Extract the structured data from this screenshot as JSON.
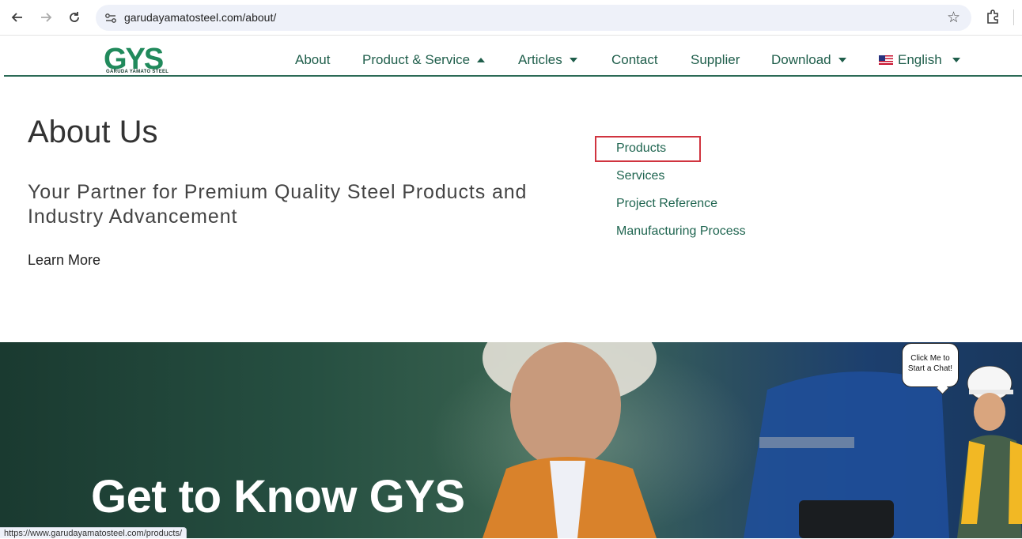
{
  "browser": {
    "url": "garudayamatosteel.com/about/"
  },
  "header": {
    "logo_text": "GYS",
    "logo_subtitle": "GARUDA YAMATO STEEL",
    "menu": {
      "about": "About",
      "product_service": "Product & Service",
      "articles": "Articles",
      "contact": "Contact",
      "supplier": "Supplier",
      "download": "Download",
      "language": "English"
    }
  },
  "about": {
    "title": "About Us",
    "tagline": "Your Partner for Premium Quality Steel Products and Industry Advancement",
    "learn_more": "Learn More"
  },
  "dropdown": {
    "items": [
      "Products",
      "Services",
      "Project Reference",
      "Manufacturing Process"
    ]
  },
  "hero": {
    "title": "Get to Know GYS"
  },
  "chat": {
    "line1": "Click Me to",
    "line2": "Start a Chat!"
  },
  "status_bar": {
    "url": "https://www.garudayamatosteel.com/products/"
  },
  "colors": {
    "brand_green": "#1f5e4b",
    "highlight_red": "#d0343f"
  }
}
